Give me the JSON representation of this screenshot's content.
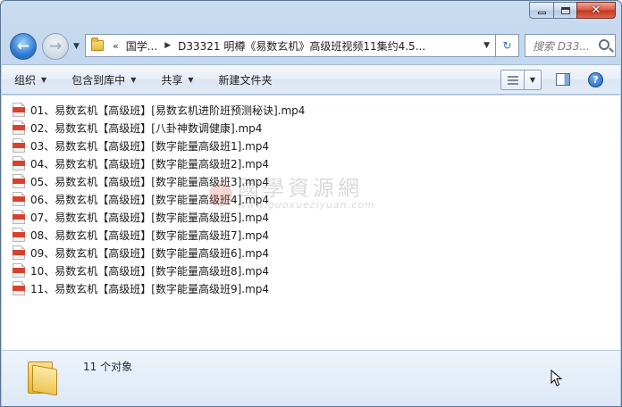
{
  "address": {
    "crumbs": [
      "国学...",
      "D33321 明樽《易数玄机》高级班视频11集约4.5..."
    ],
    "overflow_chevron": "«"
  },
  "search": {
    "placeholder": "搜索 D33..."
  },
  "toolbar": {
    "organize": "组织",
    "include_in_library": "包含到库中",
    "share": "共享",
    "new_folder": "新建文件夹"
  },
  "files": [
    "01、易数玄机【高级班】[易数玄机进阶班预测秘诀].mp4",
    "02、易数玄机【高级班】[八卦神数调健康].mp4",
    "03、易数玄机【高级班】[数字能量高级班1].mp4",
    "04、易数玄机【高级班】[数字能量高级班2].mp4",
    "05、易数玄机【高级班】[数字能量高级班3].mp4",
    "06、易数玄机【高级班】[数字能量高级班4].mp4",
    "07、易数玄机【高级班】[数字能量高级班5].mp4",
    "08、易数玄机【高级班】[数字能量高级班7].mp4",
    "09、易数玄机【高级班】[数字能量高级班6].mp4",
    "10、易数玄机【高级班】[数字能量高级班8].mp4",
    "11、易数玄机【高级班】[数字能量高级班9].mp4"
  ],
  "watermark": {
    "cn": "國學資源網",
    "en": "www.guoxueziyuan.com"
  },
  "details": {
    "count": "11 个对象"
  },
  "icons": {
    "file": "mp4-file-icon",
    "folder": "folder-icon",
    "help": "help-icon",
    "search": "search-icon"
  }
}
